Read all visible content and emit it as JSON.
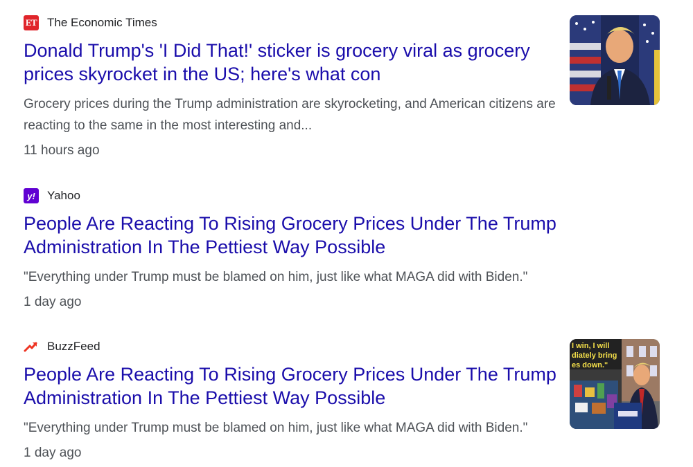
{
  "articles": [
    {
      "source": "The Economic Times",
      "favicon_text": "ET",
      "headline": "Donald Trump's 'I Did That!' sticker is grocery viral as grocery prices skyrocket in the US; here's what con",
      "snippet": "Grocery prices during the Trump administration are skyrocketing, and American citizens are reacting to the same in the most interesting and...",
      "time": "11 hours ago"
    },
    {
      "source": "Yahoo",
      "favicon_text": "y!",
      "headline": "People Are Reacting To Rising Grocery Prices Under The Trump Administration In The Pettiest Way Possible",
      "snippet": "\"Everything under Trump must be blamed on him, just like what MAGA did with Biden.\"",
      "time": "1 day ago"
    },
    {
      "source": "BuzzFeed",
      "headline": "People Are Reacting To Rising Grocery Prices Under The Trump Administration In The Pettiest Way Possible",
      "snippet": "\"Everything under Trump must be blamed on him, just like what MAGA did with Biden.\"",
      "time": "1 day ago",
      "thumb_caption": "I win, I will diately bring es down."
    }
  ],
  "colors": {
    "headline": "#1a0dab",
    "snippet": "#4d5156",
    "et_brand": "#e0252b",
    "yahoo_brand": "#6001d2",
    "buzzfeed_brand": "#ee3322"
  }
}
